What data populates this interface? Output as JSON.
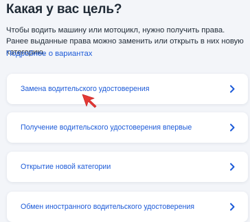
{
  "header": {
    "title": "Какая у вас цель?",
    "description": "Чтобы водить машину или мотоцикл, нужно получить права. Ранее выданные права можно заменить или открыть в них новую категорию.",
    "more_link": "Подробнее о вариантах"
  },
  "options": [
    {
      "label": "Замена водительского удостоверения",
      "icon": "chevron-right-icon"
    },
    {
      "label": "Получение водительского удостоверения впервые",
      "icon": "chevron-right-icon"
    },
    {
      "label": "Открытие новой категории",
      "icon": "chevron-right-icon"
    },
    {
      "label": "Обмен иностранного водительского удостоверения",
      "icon": "chevron-right-icon"
    }
  ],
  "cursor": {
    "icon": "pointer-arrow-icon",
    "color": "#e53935"
  },
  "colors": {
    "link": "#1d5bd8",
    "text": "#1f2a36",
    "background": "#f3f5f9",
    "card": "#ffffff"
  }
}
